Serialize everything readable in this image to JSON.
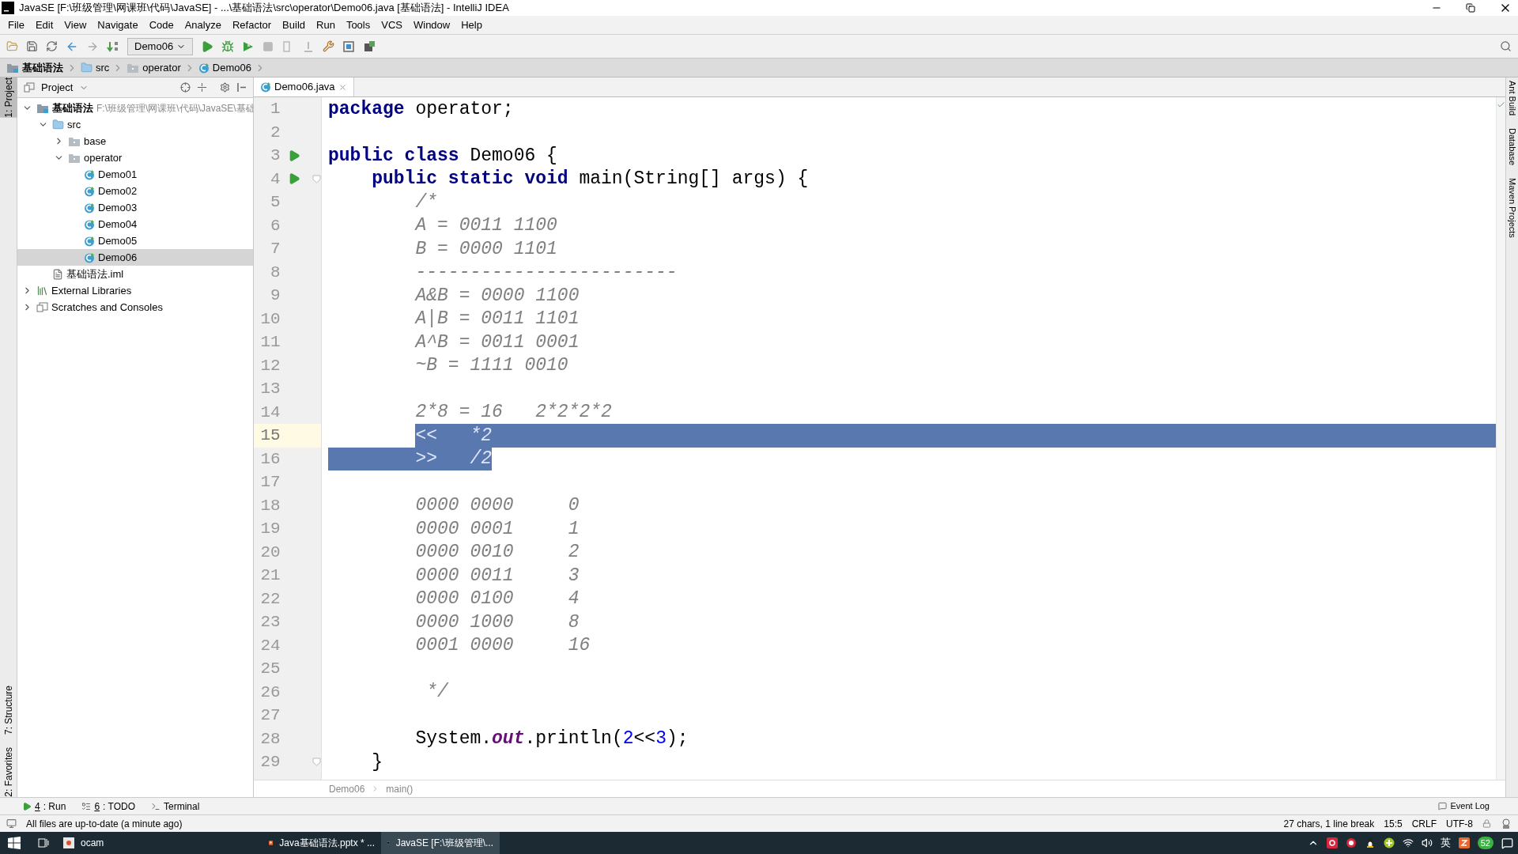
{
  "window": {
    "title": "JavaSE [F:\\班级管理\\网课班\\代码\\JavaSE] - ...\\基础语法\\src\\operator\\Demo06.java [基础语法] - IntelliJ IDEA"
  },
  "menu": [
    "File",
    "Edit",
    "View",
    "Navigate",
    "Code",
    "Analyze",
    "Refactor",
    "Build",
    "Run",
    "Tools",
    "VCS",
    "Window",
    "Help"
  ],
  "toolbar": {
    "run_config": "Demo06"
  },
  "navbar": [
    {
      "label": "基础语法",
      "kind": "module"
    },
    {
      "label": "src",
      "kind": "folder"
    },
    {
      "label": "operator",
      "kind": "package"
    },
    {
      "label": "Demo06",
      "kind": "class"
    }
  ],
  "left_stripe": {
    "top": [
      {
        "label": "1: Project",
        "selected": true
      }
    ],
    "bottom": [
      {
        "label": "7: Structure",
        "selected": false
      },
      {
        "label": "2: Favorites",
        "selected": false
      }
    ]
  },
  "right_stripe": [
    "Ant Build",
    "Database",
    "Maven Projects"
  ],
  "project": {
    "title": "Project",
    "tree": [
      {
        "label": "基础语法",
        "kind": "module",
        "path": "F:\\班级管理\\网课班\\代码\\JavaSE\\基础",
        "expanded": true,
        "selected": false,
        "children": [
          {
            "label": "src",
            "kind": "folder",
            "expanded": true,
            "selected": false,
            "children": [
              {
                "label": "base",
                "kind": "package",
                "expanded": false,
                "selected": false
              },
              {
                "label": "operator",
                "kind": "package",
                "expanded": true,
                "selected": false,
                "children": [
                  {
                    "label": "Demo01",
                    "kind": "class",
                    "selected": false
                  },
                  {
                    "label": "Demo02",
                    "kind": "class",
                    "selected": false
                  },
                  {
                    "label": "Demo03",
                    "kind": "class",
                    "selected": false
                  },
                  {
                    "label": "Demo04",
                    "kind": "class",
                    "selected": false
                  },
                  {
                    "label": "Demo05",
                    "kind": "class",
                    "selected": false
                  },
                  {
                    "label": "Demo06",
                    "kind": "class",
                    "selected": true
                  }
                ]
              }
            ]
          },
          {
            "label": "基础语法.iml",
            "kind": "file",
            "selected": false
          }
        ]
      },
      {
        "label": "External Libraries",
        "kind": "library",
        "expanded": false,
        "selected": false
      },
      {
        "label": "Scratches and Consoles",
        "kind": "scratches",
        "expanded": false,
        "selected": false
      }
    ]
  },
  "editor": {
    "tabs": [
      {
        "label": "Demo06.java",
        "selected": true
      }
    ],
    "lines": [
      {
        "number": "1",
        "tokens": [
          {
            "text": "package",
            "kind": "keyword"
          },
          {
            "text": " operator;",
            "kind": "plain"
          }
        ]
      },
      {
        "number": "2"
      },
      {
        "number": "3",
        "run": true,
        "tokens": [
          {
            "text": "public class",
            "kind": "keyword"
          },
          {
            "text": " Demo06 {",
            "kind": "plain"
          }
        ]
      },
      {
        "number": "4",
        "run": true,
        "fold": true,
        "tokens": [
          {
            "text": "    public static void",
            "kind": "keyword"
          },
          {
            "text": " main(String[] args) {",
            "kind": "plain"
          }
        ]
      },
      {
        "number": "5",
        "tokens": [
          {
            "text": "        /*",
            "kind": "comment"
          }
        ]
      },
      {
        "number": "6",
        "tokens": [
          {
            "text": "        A = 0011 1100",
            "kind": "comment"
          }
        ]
      },
      {
        "number": "7",
        "tokens": [
          {
            "text": "        B = 0000 1101",
            "kind": "comment"
          }
        ]
      },
      {
        "number": "8",
        "tokens": [
          {
            "text": "        ------------------------",
            "kind": "comment"
          }
        ]
      },
      {
        "number": "9",
        "tokens": [
          {
            "text": "        A&B = 0000 1100",
            "kind": "comment"
          }
        ]
      },
      {
        "number": "10",
        "tokens": [
          {
            "text": "        A|B = 0011 1101",
            "kind": "comment"
          }
        ]
      },
      {
        "number": "11",
        "tokens": [
          {
            "text": "        A^B = 0011 0001",
            "kind": "comment"
          }
        ]
      },
      {
        "number": "12",
        "tokens": [
          {
            "text": "        ~B = 1111 0010",
            "kind": "comment"
          }
        ]
      },
      {
        "number": "13"
      },
      {
        "number": "14",
        "tokens": [
          {
            "text": "        2*8 = 16   2*2*2*2",
            "kind": "comment"
          }
        ]
      },
      {
        "number": "15",
        "current": true,
        "selected": true,
        "tokens": [
          {
            "text": "        <<   *2",
            "kind": "comment"
          }
        ]
      },
      {
        "number": "16",
        "selected": true,
        "tokens": [
          {
            "text": "        >>   /2",
            "kind": "comment"
          }
        ]
      },
      {
        "number": "17"
      },
      {
        "number": "18",
        "tokens": [
          {
            "text": "        0000 0000     0",
            "kind": "comment"
          }
        ]
      },
      {
        "number": "19",
        "tokens": [
          {
            "text": "        0000 0001     1",
            "kind": "comment"
          }
        ]
      },
      {
        "number": "20",
        "tokens": [
          {
            "text": "        0000 0010     2",
            "kind": "comment"
          }
        ]
      },
      {
        "number": "21",
        "tokens": [
          {
            "text": "        0000 0011     3",
            "kind": "comment"
          }
        ]
      },
      {
        "number": "22",
        "tokens": [
          {
            "text": "        0000 0100     4",
            "kind": "comment"
          }
        ]
      },
      {
        "number": "23",
        "tokens": [
          {
            "text": "        0000 1000     8",
            "kind": "comment"
          }
        ]
      },
      {
        "number": "24",
        "tokens": [
          {
            "text": "        0001 0000     16",
            "kind": "comment"
          }
        ]
      },
      {
        "number": "25"
      },
      {
        "number": "26",
        "tokens": [
          {
            "text": "         */",
            "kind": "comment"
          }
        ]
      },
      {
        "number": "27"
      },
      {
        "number": "28",
        "tokens": [
          {
            "text": "        System.",
            "kind": "plain"
          },
          {
            "text": "out",
            "kind": "field"
          },
          {
            "text": ".println(",
            "kind": "plain"
          },
          {
            "text": "2",
            "kind": "number"
          },
          {
            "text": "<<",
            "kind": "plain"
          },
          {
            "text": "3",
            "kind": "number"
          },
          {
            "text": ");",
            "kind": "plain"
          }
        ]
      },
      {
        "number": "29",
        "fold": true,
        "tokens": [
          {
            "text": "    }",
            "kind": "plain"
          }
        ]
      }
    ],
    "breadcrumb": [
      "Demo06",
      "main()"
    ]
  },
  "tool_buttons": [
    {
      "number": "4",
      "label": ": Run",
      "kind": "run"
    },
    {
      "number": "6",
      "label": ": TODO",
      "kind": "todo"
    },
    {
      "label": "Terminal",
      "kind": "terminal"
    }
  ],
  "event_log": "Event Log",
  "status_bar": {
    "message": "All files are up-to-date (a minute ago)",
    "selection": "27 chars, 1 line break",
    "position": "15:5",
    "line_separator": "CRLF",
    "encoding": "UTF-8"
  },
  "taskbar": {
    "apps": [
      {
        "label": "ocam",
        "kind": "ocam",
        "selected": false
      },
      {
        "label": "Java基础语法.pptx * ...",
        "kind": "pptx",
        "selected": false
      },
      {
        "label": "JavaSE [F:\\班级管理\\...",
        "kind": "idea",
        "selected": true
      }
    ],
    "ime": "英",
    "badge": "52"
  }
}
